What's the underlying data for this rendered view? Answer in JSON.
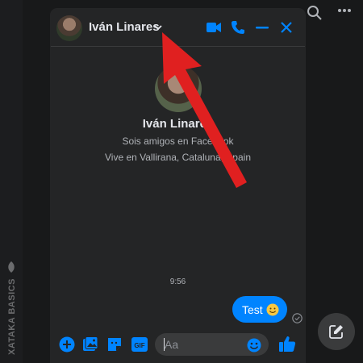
{
  "header": {
    "contact_name": "Iván Linares"
  },
  "profile": {
    "name": "Iván Linares",
    "relationship": "Sois amigos en Facebook",
    "location": "Vive en Vallirana, Cataluna, Spain"
  },
  "conversation": {
    "timestamp": "9:56",
    "messages": [
      {
        "text": "Test",
        "emoji": "slightly-smiling-face-icon",
        "from": "me"
      }
    ]
  },
  "composer": {
    "placeholder": "Aa",
    "gif_label": "GIF"
  },
  "watermark": {
    "text": "XATAKA BASICS"
  },
  "colors": {
    "accent": "#0084ff",
    "panel": "#242526",
    "background": "#18191a",
    "annotation_arrow": "#e02020"
  }
}
